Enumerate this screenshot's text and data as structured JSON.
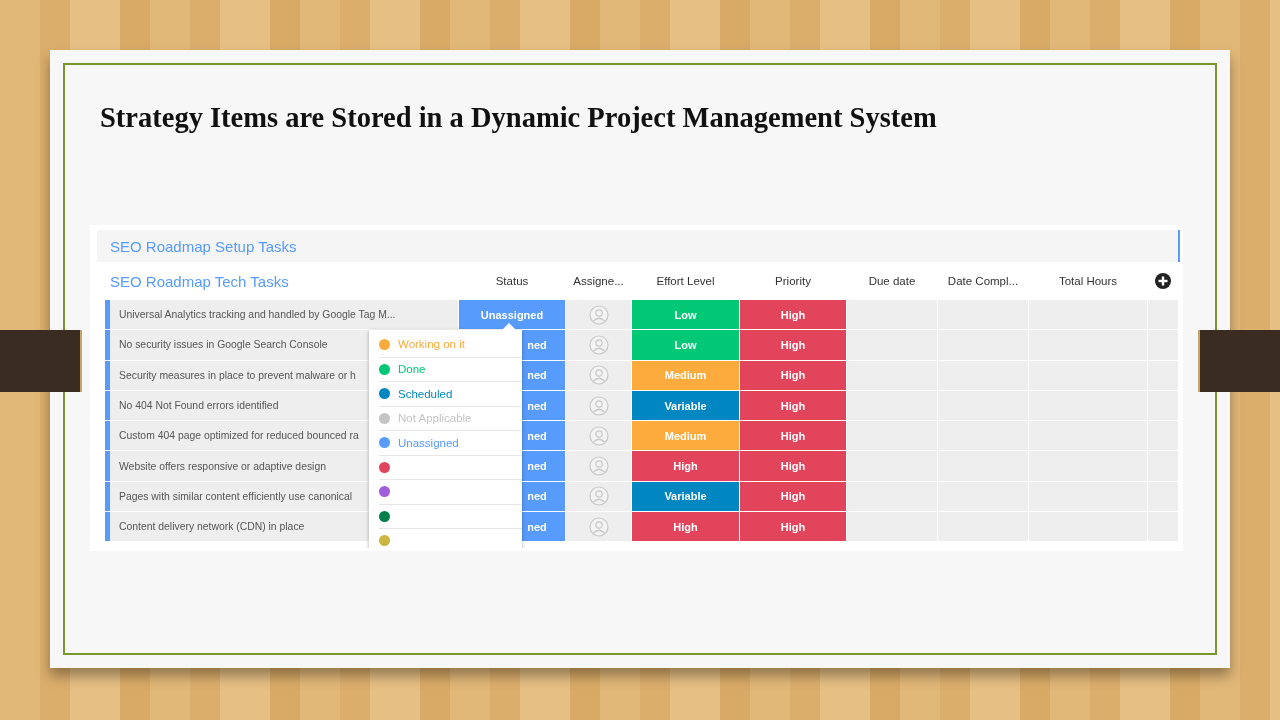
{
  "slide": {
    "title": "Strategy Items are Stored in a Dynamic Project Management System"
  },
  "collapsed_group": {
    "title": "SEO Roadmap Setup Tasks"
  },
  "group": {
    "title": "SEO Roadmap Tech Tasks",
    "color": "#579bfc",
    "columns": [
      "Status",
      "Assigne...",
      "Effort Level",
      "Priority",
      "Due date",
      "Date Compl...",
      "Total Hours"
    ],
    "rows": [
      {
        "task": "Universal Analytics tracking and handled by Google Tag M...",
        "status": {
          "label": "Unassigned",
          "color": "#579bfc"
        },
        "effort": {
          "label": "Low",
          "color": "#00c875"
        },
        "priority": {
          "label": "High",
          "color": "#e2445c"
        }
      },
      {
        "task": "No security issues in Google Search Console",
        "status": {
          "label": "ned",
          "color": "#579bfc"
        },
        "effort": {
          "label": "Low",
          "color": "#00c875"
        },
        "priority": {
          "label": "High",
          "color": "#e2445c"
        }
      },
      {
        "task": "Security measures in place to prevent malware or h",
        "status": {
          "label": "ned",
          "color": "#579bfc"
        },
        "effort": {
          "label": "Medium",
          "color": "#fdab3d"
        },
        "priority": {
          "label": "High",
          "color": "#e2445c"
        }
      },
      {
        "task": "No 404 Not Found errors identified",
        "status": {
          "label": "ned",
          "color": "#579bfc"
        },
        "effort": {
          "label": "Variable",
          "color": "#0086c0"
        },
        "priority": {
          "label": "High",
          "color": "#e2445c"
        }
      },
      {
        "task": "Custom 404 page optimized for reduced bounced ra",
        "status": {
          "label": "ned",
          "color": "#579bfc"
        },
        "effort": {
          "label": "Medium",
          "color": "#fdab3d"
        },
        "priority": {
          "label": "High",
          "color": "#e2445c"
        }
      },
      {
        "task": "Website offers responsive or adaptive design",
        "status": {
          "label": "ned",
          "color": "#579bfc"
        },
        "effort": {
          "label": "High",
          "color": "#e2445c"
        },
        "priority": {
          "label": "High",
          "color": "#e2445c"
        }
      },
      {
        "task": "Pages with similar content efficiently use canonical",
        "status": {
          "label": "ned",
          "color": "#579bfc"
        },
        "effort": {
          "label": "Variable",
          "color": "#0086c0"
        },
        "priority": {
          "label": "High",
          "color": "#e2445c"
        }
      },
      {
        "task": "Content delivery network (CDN) in place",
        "status": {
          "label": "ned",
          "color": "#579bfc"
        },
        "effort": {
          "label": "High",
          "color": "#e2445c"
        },
        "priority": {
          "label": "High",
          "color": "#e2445c"
        }
      }
    ]
  },
  "status_menu": {
    "items": [
      {
        "label": "Working on it",
        "color": "#fdab3d"
      },
      {
        "label": "Done",
        "color": "#00c875"
      },
      {
        "label": "Scheduled",
        "color": "#0086c0"
      },
      {
        "label": "Not Applicable",
        "color": "#c4c4c4"
      },
      {
        "label": "Unassigned",
        "color": "#579bfc"
      },
      {
        "color": "#e2445c"
      },
      {
        "color": "#a25ddc"
      },
      {
        "color": "#037f4c"
      },
      {
        "color": "#cab641"
      }
    ]
  }
}
